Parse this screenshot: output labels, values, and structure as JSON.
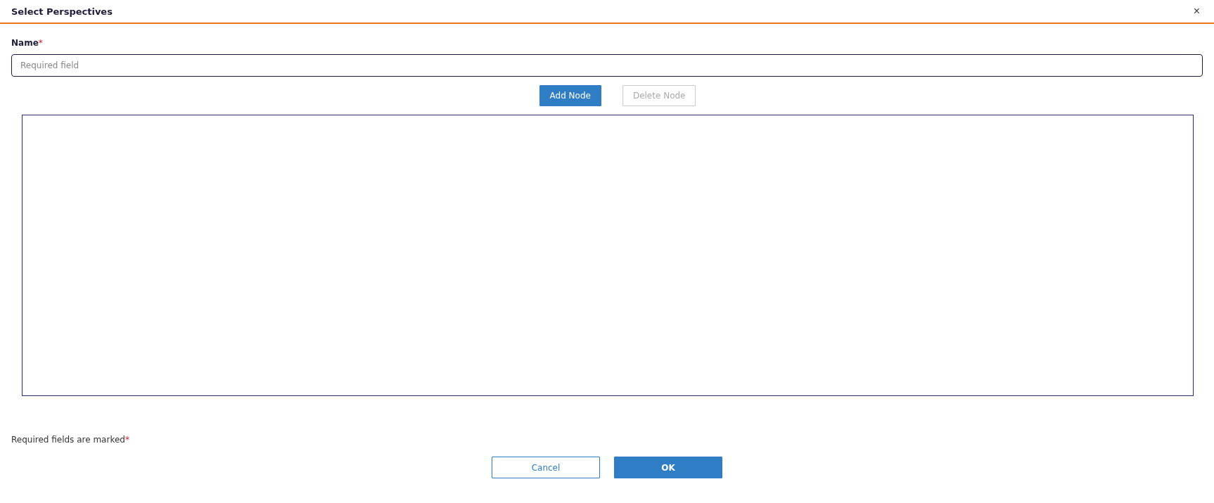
{
  "dialog": {
    "title": "Select Perspectives",
    "close": "×"
  },
  "name_field": {
    "label": "Name",
    "required_mark": "*",
    "placeholder": "Required field"
  },
  "toolbar": [
    {
      "label": "Add Node",
      "disabled": false
    },
    {
      "label": "Delete Node",
      "disabled": true
    }
  ],
  "footer_note": {
    "text": "Required fields are marked",
    "required_mark": "*"
  },
  "buttons": [
    {
      "label": "Cancel",
      "kind": "secondary"
    },
    {
      "label": "OK",
      "kind": "primary"
    }
  ]
}
